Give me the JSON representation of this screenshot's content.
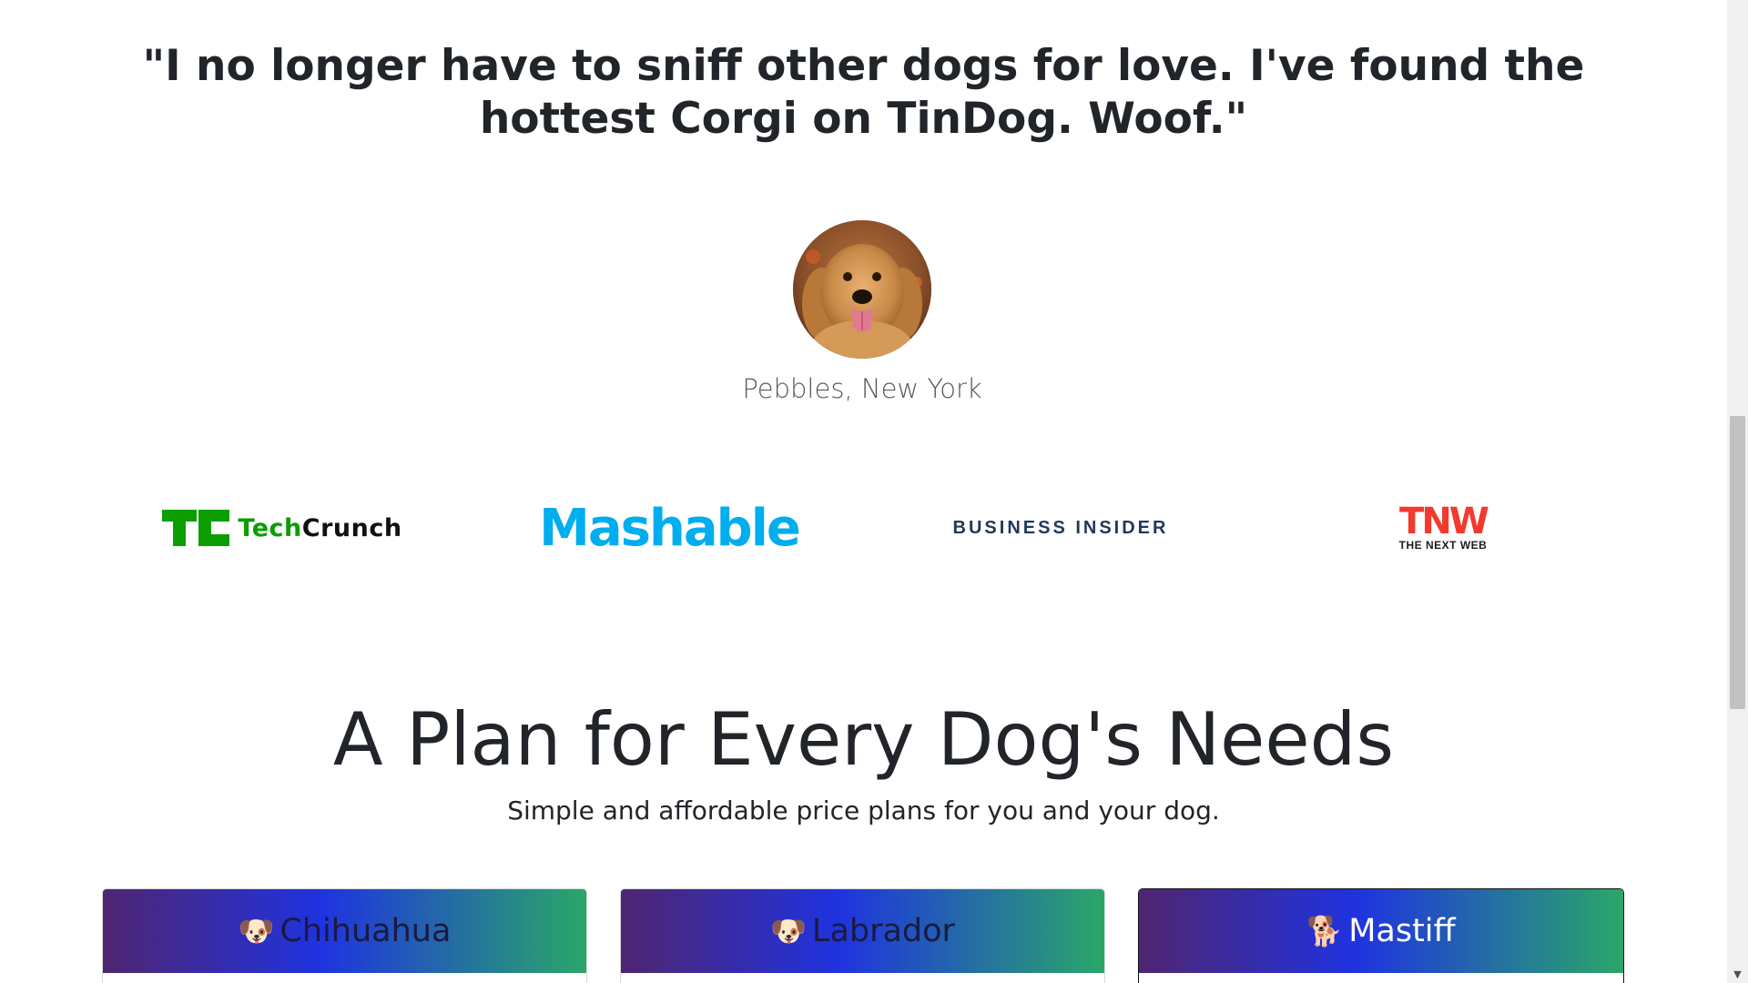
{
  "testimonial": {
    "quote": "\"I no longer have to sniff other dogs for love. I've found the hottest Corgi on TinDog. Woof.\"",
    "author": "Pebbles, New York"
  },
  "press": {
    "techcrunch_tech": "Tech",
    "techcrunch_crunch": "Crunch",
    "mashable": "Mashable",
    "business_insider": "BUSINESS INSIDER",
    "tnw_big": "TNW",
    "tnw_small": "THE NEXT WEB"
  },
  "pricing": {
    "title": "A Plan for Every Dog's Needs",
    "subtitle": "Simple and affordable price plans for you and your dog.",
    "plans": [
      {
        "icon": "🐶",
        "name": "Chihuahua"
      },
      {
        "icon": "🐶",
        "name": "Labrador"
      },
      {
        "icon": "🐕",
        "name": "Mastiff"
      }
    ]
  },
  "colors": {
    "techcrunch_green": "#0a9e01",
    "mashable_blue": "#00aeef",
    "business_insider_navy": "#1f3a5a",
    "tnw_red": "#f23a2d",
    "gradient_start": "#4f2570",
    "gradient_mid": "#1f33e0",
    "gradient_end": "#2aa768"
  },
  "icons": {
    "avatar": "golden-retriever-photo",
    "scroll_down": "triangle-down-icon"
  }
}
